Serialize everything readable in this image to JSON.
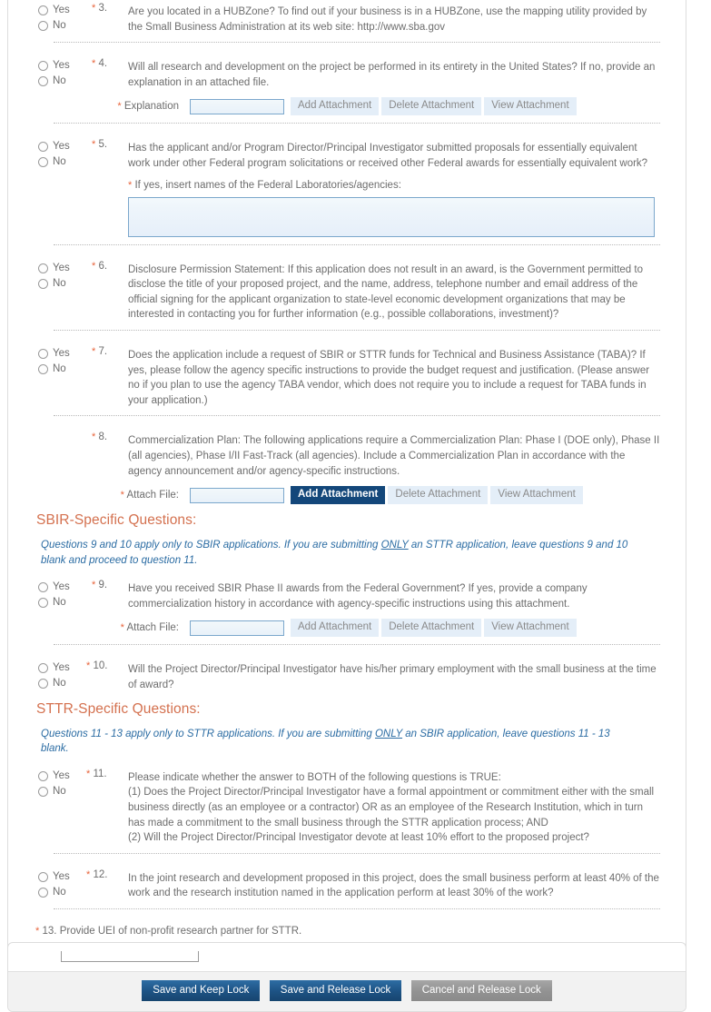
{
  "form": {
    "questions": [
      {
        "number": "3.",
        "required": true,
        "has_radios": true,
        "yes_label": "Yes",
        "no_label": "No",
        "text": "Are you located in a HUBZone? To find out if your business is in a HUBZone, use the mapping utility provided by the Small Business Administration at its web site: http://www.sba.gov"
      },
      {
        "number": "4.",
        "required": true,
        "has_radios": true,
        "yes_label": "Yes",
        "no_label": "No",
        "text": "Will all research and development on the project be performed in its entirety in the United States? If no, provide an explanation in an attached file.",
        "attachment": {
          "label": "Explanation",
          "label_required": true,
          "value": "",
          "add_label": "Add Attachment",
          "delete_label": "Delete Attachment",
          "view_label": "View Attachment",
          "add_active": false
        }
      },
      {
        "number": "5.",
        "required": true,
        "has_radios": true,
        "yes_label": "Yes",
        "no_label": "No",
        "text": "Has the applicant and/or Program Director/Principal Investigator submitted proposals for essentially equivalent work under other Federal program solicitations or received other Federal awards for essentially equivalent work?",
        "sub_label": "If yes, insert names of the Federal Laboratories/agencies:",
        "sub_label_required": true,
        "textarea_value": ""
      },
      {
        "number": "6.",
        "required": true,
        "has_radios": true,
        "yes_label": "Yes",
        "no_label": "No",
        "text": "Disclosure Permission Statement: If this application does not result in an award, is the Government permitted to disclose the title of your proposed project, and the name, address, telephone number and email address of the official signing for the applicant organization to state-level economic development organizations that may be interested in contacting you for further information (e.g., possible collaborations, investment)?"
      },
      {
        "number": "7.",
        "required": true,
        "has_radios": true,
        "yes_label": "Yes",
        "no_label": "No",
        "text": "Does the application include a request of SBIR or STTR funds for Technical and Business Assistance (TABA)? If yes, please follow the agency specific instructions to provide the budget request and justification. (Please answer no if you plan to use the agency TABA vendor, which does not require you to include a request for TABA funds in your application.)"
      },
      {
        "number": "8.",
        "required": true,
        "has_radios": false,
        "text": "Commercialization Plan: The following applications require a Commercialization Plan: Phase I (DOE only), Phase II (all agencies), Phase I/II Fast-Track (all agencies). Include a Commercialization Plan in accordance with the agency announcement and/or agency-specific instructions.",
        "attachment": {
          "label": "Attach File:",
          "label_required": true,
          "value": "",
          "add_label": "Add Attachment",
          "delete_label": "Delete Attachment",
          "view_label": "View Attachment",
          "add_active": true
        }
      }
    ],
    "sbir_section": {
      "heading": "SBIR-Specific Questions:",
      "note_before": "Questions 9 and 10 apply only to SBIR applications. If you are submitting ",
      "note_emphasis": "ONLY",
      "note_after": " an STTR application, leave questions 9 and 10 blank and proceed to question 11.",
      "questions": [
        {
          "number": "9.",
          "required": true,
          "has_radios": true,
          "yes_label": "Yes",
          "no_label": "No",
          "text": "Have you received SBIR Phase II awards from the Federal Government? If yes, provide a company commercialization history in accordance with agency-specific instructions using this attachment.",
          "attachment": {
            "label": "Attach File:",
            "label_required": true,
            "value": "",
            "add_label": "Add Attachment",
            "delete_label": "Delete Attachment",
            "view_label": "View Attachment",
            "add_active": false
          }
        },
        {
          "number": "10.",
          "required": true,
          "has_radios": true,
          "yes_label": "Yes",
          "no_label": "No",
          "text": "Will the Project Director/Principal Investigator have his/her primary employment with the small business at the time of award?"
        }
      ]
    },
    "sttr_section": {
      "heading": "STTR-Specific Questions:",
      "note_before": "Questions 11 - 13 apply only to STTR applications. If you are submitting ",
      "note_emphasis": "ONLY",
      "note_after": " an SBIR application, leave questions 11 - 13 blank.",
      "questions": [
        {
          "number": "11.",
          "required": true,
          "has_radios": true,
          "yes_label": "Yes",
          "no_label": "No",
          "text_line1": "Please indicate whether the answer to BOTH of the following questions is TRUE:",
          "text_line2": "(1) Does the Project Director/Principal Investigator have a formal appointment or commitment either with the small business directly (as an employee or a contractor) OR as an employee of the Research Institution, which in turn has made a commitment to the small business through the STTR application process; AND",
          "text_line3": "(2) Will the Project Director/Principal Investigator devote at least 10% effort to the proposed project?"
        },
        {
          "number": "12.",
          "required": true,
          "has_radios": true,
          "yes_label": "Yes",
          "no_label": "No",
          "text": "In the joint research and development proposed in this project, does the small business perform at least 40% of the work and the research institution named in the application perform at least 30% of the work?"
        }
      ],
      "question13": {
        "number": "13.",
        "required": true,
        "label": "Provide UEI of non-profit research partner for STTR.",
        "value": ""
      }
    },
    "footer": {
      "save_keep_lock": "Save and Keep Lock",
      "save_release_lock": "Save and Release Lock",
      "cancel_release_lock": "Cancel and Release Lock"
    }
  },
  "colors": {
    "section_heading": "#d4714f",
    "note_text": "#2b6ca3",
    "required_star": "#e8633a",
    "body_text": "#6d6d6d",
    "active_button": "#13477a",
    "footer_button": "#1d5283",
    "cancel_button": "#929292"
  }
}
